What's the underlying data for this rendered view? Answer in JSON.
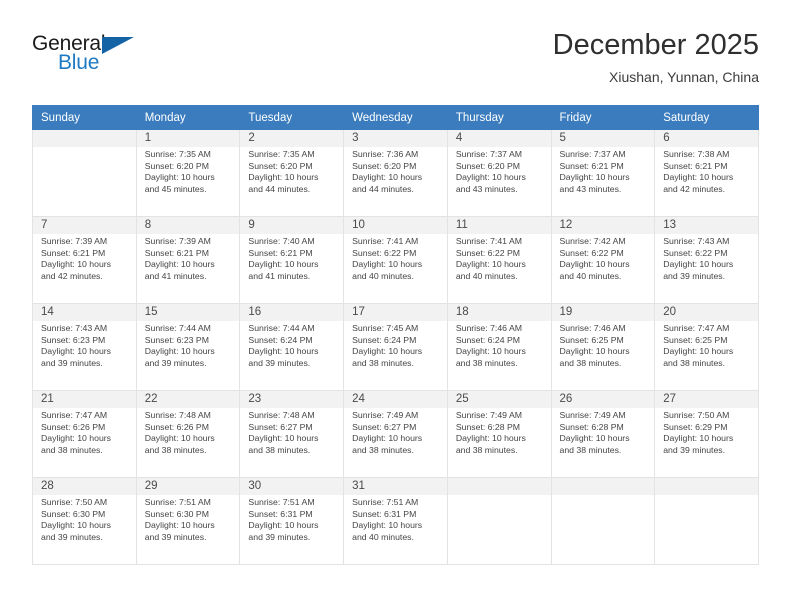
{
  "brand": {
    "word_one": "General",
    "word_two": "Blue",
    "logo_icon": "triangle-flag-icon",
    "accent_color": "#1f7ac4",
    "triangle_color": "#1464a5"
  },
  "header": {
    "month_title": "December 2025",
    "location": "Xiushan, Yunnan, China"
  },
  "calendar": {
    "header_bg": "#3a7cbe",
    "stripe_bg": "#f2f2f2",
    "border_color": "#e3e3e3",
    "weekday_headers": [
      "Sunday",
      "Monday",
      "Tuesday",
      "Wednesday",
      "Thursday",
      "Friday",
      "Saturday"
    ],
    "weeks": [
      [
        {
          "day": "",
          "lines": []
        },
        {
          "day": "1",
          "lines": [
            "Sunrise: 7:35 AM",
            "Sunset: 6:20 PM",
            "Daylight: 10 hours",
            "and 45 minutes."
          ]
        },
        {
          "day": "2",
          "lines": [
            "Sunrise: 7:35 AM",
            "Sunset: 6:20 PM",
            "Daylight: 10 hours",
            "and 44 minutes."
          ]
        },
        {
          "day": "3",
          "lines": [
            "Sunrise: 7:36 AM",
            "Sunset: 6:20 PM",
            "Daylight: 10 hours",
            "and 44 minutes."
          ]
        },
        {
          "day": "4",
          "lines": [
            "Sunrise: 7:37 AM",
            "Sunset: 6:20 PM",
            "Daylight: 10 hours",
            "and 43 minutes."
          ]
        },
        {
          "day": "5",
          "lines": [
            "Sunrise: 7:37 AM",
            "Sunset: 6:21 PM",
            "Daylight: 10 hours",
            "and 43 minutes."
          ]
        },
        {
          "day": "6",
          "lines": [
            "Sunrise: 7:38 AM",
            "Sunset: 6:21 PM",
            "Daylight: 10 hours",
            "and 42 minutes."
          ]
        }
      ],
      [
        {
          "day": "7",
          "lines": [
            "Sunrise: 7:39 AM",
            "Sunset: 6:21 PM",
            "Daylight: 10 hours",
            "and 42 minutes."
          ]
        },
        {
          "day": "8",
          "lines": [
            "Sunrise: 7:39 AM",
            "Sunset: 6:21 PM",
            "Daylight: 10 hours",
            "and 41 minutes."
          ]
        },
        {
          "day": "9",
          "lines": [
            "Sunrise: 7:40 AM",
            "Sunset: 6:21 PM",
            "Daylight: 10 hours",
            "and 41 minutes."
          ]
        },
        {
          "day": "10",
          "lines": [
            "Sunrise: 7:41 AM",
            "Sunset: 6:22 PM",
            "Daylight: 10 hours",
            "and 40 minutes."
          ]
        },
        {
          "day": "11",
          "lines": [
            "Sunrise: 7:41 AM",
            "Sunset: 6:22 PM",
            "Daylight: 10 hours",
            "and 40 minutes."
          ]
        },
        {
          "day": "12",
          "lines": [
            "Sunrise: 7:42 AM",
            "Sunset: 6:22 PM",
            "Daylight: 10 hours",
            "and 40 minutes."
          ]
        },
        {
          "day": "13",
          "lines": [
            "Sunrise: 7:43 AM",
            "Sunset: 6:22 PM",
            "Daylight: 10 hours",
            "and 39 minutes."
          ]
        }
      ],
      [
        {
          "day": "14",
          "lines": [
            "Sunrise: 7:43 AM",
            "Sunset: 6:23 PM",
            "Daylight: 10 hours",
            "and 39 minutes."
          ]
        },
        {
          "day": "15",
          "lines": [
            "Sunrise: 7:44 AM",
            "Sunset: 6:23 PM",
            "Daylight: 10 hours",
            "and 39 minutes."
          ]
        },
        {
          "day": "16",
          "lines": [
            "Sunrise: 7:44 AM",
            "Sunset: 6:24 PM",
            "Daylight: 10 hours",
            "and 39 minutes."
          ]
        },
        {
          "day": "17",
          "lines": [
            "Sunrise: 7:45 AM",
            "Sunset: 6:24 PM",
            "Daylight: 10 hours",
            "and 38 minutes."
          ]
        },
        {
          "day": "18",
          "lines": [
            "Sunrise: 7:46 AM",
            "Sunset: 6:24 PM",
            "Daylight: 10 hours",
            "and 38 minutes."
          ]
        },
        {
          "day": "19",
          "lines": [
            "Sunrise: 7:46 AM",
            "Sunset: 6:25 PM",
            "Daylight: 10 hours",
            "and 38 minutes."
          ]
        },
        {
          "day": "20",
          "lines": [
            "Sunrise: 7:47 AM",
            "Sunset: 6:25 PM",
            "Daylight: 10 hours",
            "and 38 minutes."
          ]
        }
      ],
      [
        {
          "day": "21",
          "lines": [
            "Sunrise: 7:47 AM",
            "Sunset: 6:26 PM",
            "Daylight: 10 hours",
            "and 38 minutes."
          ]
        },
        {
          "day": "22",
          "lines": [
            "Sunrise: 7:48 AM",
            "Sunset: 6:26 PM",
            "Daylight: 10 hours",
            "and 38 minutes."
          ]
        },
        {
          "day": "23",
          "lines": [
            "Sunrise: 7:48 AM",
            "Sunset: 6:27 PM",
            "Daylight: 10 hours",
            "and 38 minutes."
          ]
        },
        {
          "day": "24",
          "lines": [
            "Sunrise: 7:49 AM",
            "Sunset: 6:27 PM",
            "Daylight: 10 hours",
            "and 38 minutes."
          ]
        },
        {
          "day": "25",
          "lines": [
            "Sunrise: 7:49 AM",
            "Sunset: 6:28 PM",
            "Daylight: 10 hours",
            "and 38 minutes."
          ]
        },
        {
          "day": "26",
          "lines": [
            "Sunrise: 7:49 AM",
            "Sunset: 6:28 PM",
            "Daylight: 10 hours",
            "and 38 minutes."
          ]
        },
        {
          "day": "27",
          "lines": [
            "Sunrise: 7:50 AM",
            "Sunset: 6:29 PM",
            "Daylight: 10 hours",
            "and 39 minutes."
          ]
        }
      ],
      [
        {
          "day": "28",
          "lines": [
            "Sunrise: 7:50 AM",
            "Sunset: 6:30 PM",
            "Daylight: 10 hours",
            "and 39 minutes."
          ]
        },
        {
          "day": "29",
          "lines": [
            "Sunrise: 7:51 AM",
            "Sunset: 6:30 PM",
            "Daylight: 10 hours",
            "and 39 minutes."
          ]
        },
        {
          "day": "30",
          "lines": [
            "Sunrise: 7:51 AM",
            "Sunset: 6:31 PM",
            "Daylight: 10 hours",
            "and 39 minutes."
          ]
        },
        {
          "day": "31",
          "lines": [
            "Sunrise: 7:51 AM",
            "Sunset: 6:31 PM",
            "Daylight: 10 hours",
            "and 40 minutes."
          ]
        },
        {
          "day": "",
          "lines": []
        },
        {
          "day": "",
          "lines": []
        },
        {
          "day": "",
          "lines": []
        }
      ]
    ]
  }
}
